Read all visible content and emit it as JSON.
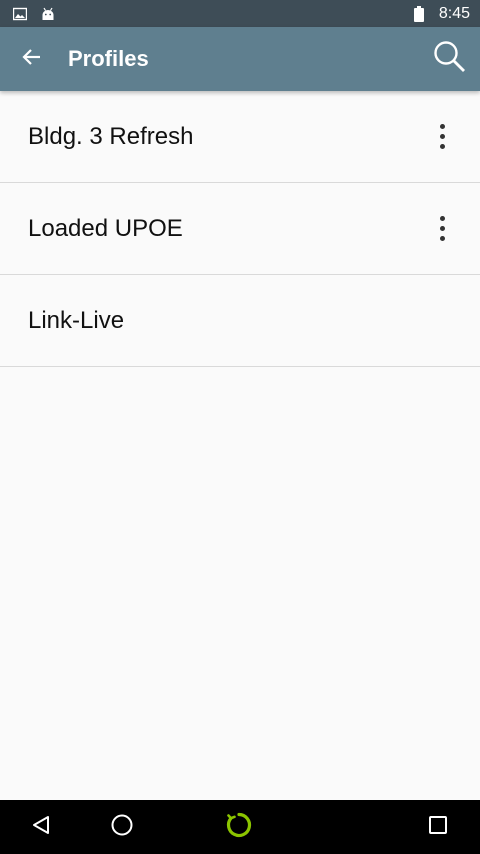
{
  "status_bar": {
    "time": "8:45",
    "icons_left": [
      "image-icon",
      "android-icon"
    ],
    "icons_right": [
      "battery-icon"
    ]
  },
  "app_bar": {
    "title": "Profiles",
    "color": "#5f7f8f"
  },
  "profiles": [
    {
      "label": "Bldg. 3 Refresh",
      "has_menu": true
    },
    {
      "label": "Loaded UPOE",
      "has_menu": true
    },
    {
      "label": "Link-Live",
      "has_menu": false
    }
  ],
  "nav_bar": {
    "buttons": [
      "back-icon",
      "home-icon",
      "assistant-ring-icon",
      "recents-icon"
    ],
    "accent_color": "#8bc400"
  }
}
